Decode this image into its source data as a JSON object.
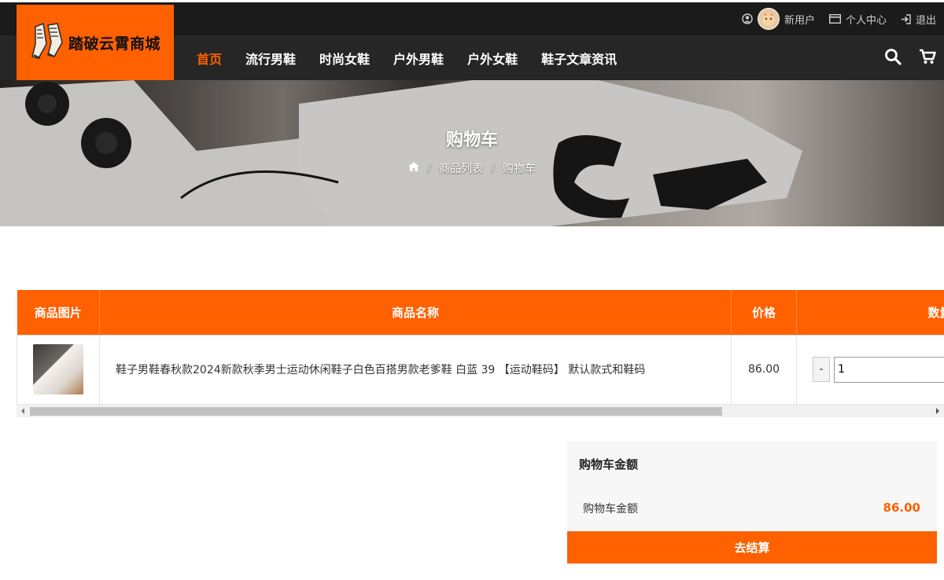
{
  "header": {
    "logo_text": "踏破云霄商城",
    "user_name": "新用户",
    "user_center": "个人中心",
    "logout": "退出"
  },
  "nav": {
    "items": [
      "首页",
      "流行男鞋",
      "时尚女鞋",
      "户外男鞋",
      "户外女鞋",
      "鞋子文章资讯"
    ],
    "active_index": 0
  },
  "banner": {
    "title": "购物车",
    "breadcrumb": [
      "商品列表",
      "购物车"
    ]
  },
  "cart": {
    "columns": [
      "商品图片",
      "商品名称",
      "价格",
      "数量"
    ],
    "rows": [
      {
        "name": "鞋子男鞋春秋款2024新款秋季男士运动休闲鞋子白色百搭男款老爹鞋 白蓝 39 【运动鞋码】 默认款式和鞋码",
        "price": "86.00",
        "quantity": "1"
      }
    ],
    "minus_label": "-"
  },
  "totals": {
    "title": "购物车金额",
    "label": "购物车金额",
    "value": "86.00",
    "checkout_label": "去结算"
  },
  "colors": {
    "accent": "#ff6000",
    "dark": "#1b1b1b"
  }
}
